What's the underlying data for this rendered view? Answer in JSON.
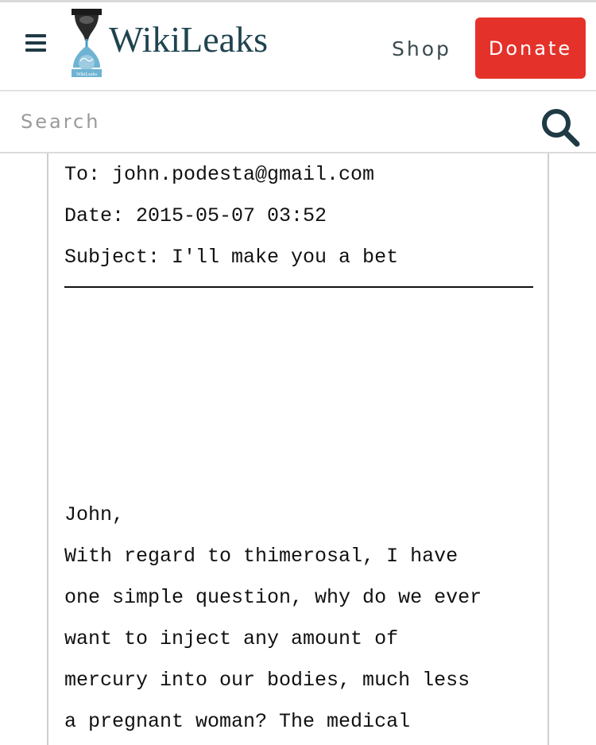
{
  "header": {
    "logo_text": "WikiLeaks",
    "logo_badge_text": "WikiLeaks",
    "shop_label": "Shop",
    "donate_label": "Donate",
    "donate_color": "#e4322b",
    "brand_color": "#1f4450"
  },
  "search": {
    "placeholder": "Search",
    "value": ""
  },
  "email": {
    "to": "To: john.podesta@gmail.com",
    "date": "Date: 2015-05-07 03:52",
    "subject": "Subject: I'll make you a bet",
    "body_lines": [
      "John,",
      "With regard to thimerosal, I have",
      "one simple question, why do we ever",
      "want to inject any amount of",
      "mercury into our bodies, much less",
      "a pregnant woman? The medical"
    ]
  },
  "icons": {
    "menu": "hamburger-menu-icon",
    "logo": "hourglass-globe-logo",
    "search": "magnifier-search-icon"
  }
}
